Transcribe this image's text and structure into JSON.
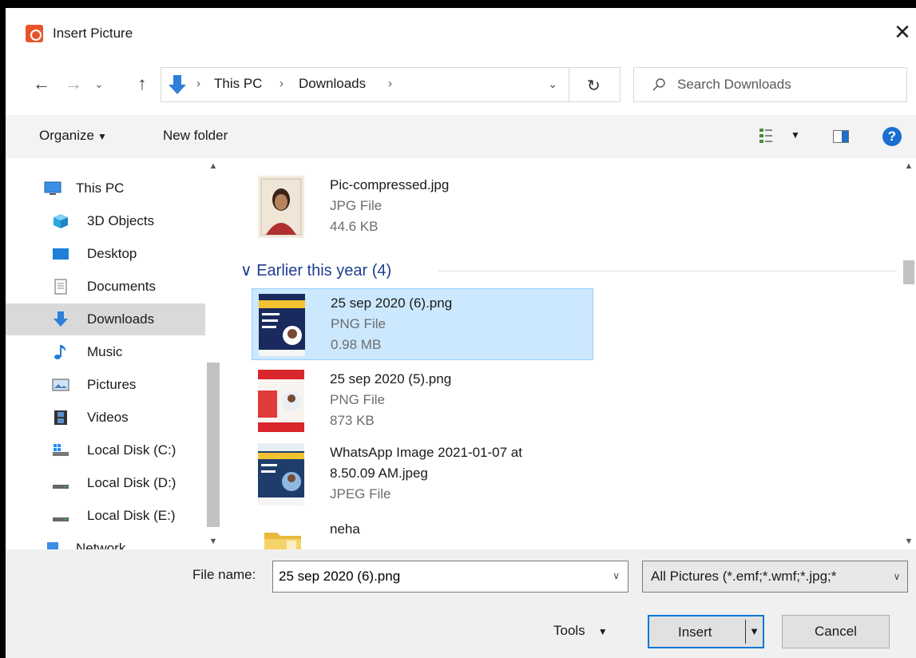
{
  "window": {
    "title": "Insert Picture",
    "close_glyph": "✕"
  },
  "nav": {
    "back": "←",
    "forward": "→",
    "recent": "⌄",
    "up": "↑"
  },
  "address": {
    "crumbs": [
      "This PC",
      "Downloads"
    ],
    "separator": "›",
    "dropdown": "⌄",
    "refresh": "↻"
  },
  "search": {
    "placeholder": "Search Downloads"
  },
  "toolbar": {
    "organize": "Organize",
    "new_folder": "New folder",
    "help": "?"
  },
  "sidebar": {
    "items": [
      {
        "label": "This PC",
        "icon": "monitor-icon"
      },
      {
        "label": "3D Objects",
        "icon": "cube-icon"
      },
      {
        "label": "Desktop",
        "icon": "desktop-icon"
      },
      {
        "label": "Documents",
        "icon": "document-icon"
      },
      {
        "label": "Downloads",
        "icon": "download-icon",
        "selected": true
      },
      {
        "label": "Music",
        "icon": "music-note-icon"
      },
      {
        "label": "Pictures",
        "icon": "pictures-icon"
      },
      {
        "label": "Videos",
        "icon": "film-icon"
      },
      {
        "label": "Local Disk (C:)",
        "icon": "drive-windows-icon"
      },
      {
        "label": "Local Disk (D:)",
        "icon": "drive-icon"
      },
      {
        "label": "Local Disk (E:)",
        "icon": "drive-icon"
      },
      {
        "label": "Network",
        "icon": "network-icon"
      }
    ]
  },
  "files": {
    "group_header": "Earlier this year (4)",
    "items": [
      {
        "name": "Pic-compressed.jpg",
        "type": "JPG File",
        "size": "44.6 KB"
      },
      {
        "name": "25 sep 2020 (6).png",
        "type": "PNG File",
        "size": "0.98 MB",
        "selected": true
      },
      {
        "name": "25 sep 2020 (5).png",
        "type": "PNG File",
        "size": "873 KB"
      },
      {
        "name_line1": "WhatsApp Image 2021-01-07 at",
        "name_line2": "8.50.09 AM.jpeg",
        "type": "JPEG File"
      },
      {
        "name": "neha"
      }
    ]
  },
  "bottom": {
    "filename_label": "File name:",
    "filename_value": "25 sep 2020 (6).png",
    "filter": "All Pictures (*.emf;*.wmf;*.jpg;*",
    "tools": "Tools",
    "insert": "Insert",
    "cancel": "Cancel"
  },
  "colors": {
    "accent": "#0078d7",
    "selection": "#cce8ff",
    "group_header": "#1e3d8f",
    "app_icon": "#e8542a"
  }
}
